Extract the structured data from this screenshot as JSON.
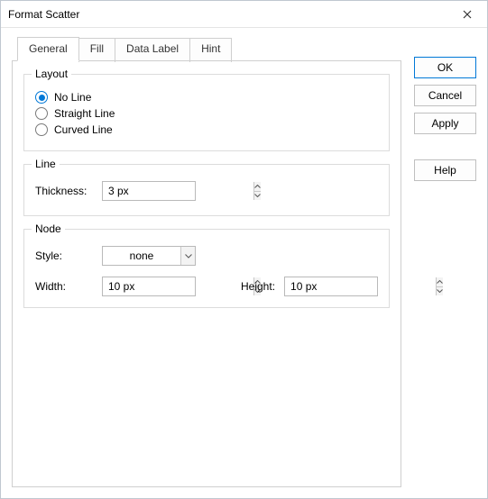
{
  "window": {
    "title": "Format Scatter"
  },
  "tabs": {
    "general": "General",
    "fill": "Fill",
    "data_label": "Data Label",
    "hint": "Hint"
  },
  "layout": {
    "title": "Layout",
    "no_line": "No Line",
    "straight_line": "Straight Line",
    "curved_line": "Curved Line",
    "selected": "no_line"
  },
  "line": {
    "title": "Line",
    "thickness_label": "Thickness:",
    "thickness_value": "3 px"
  },
  "node": {
    "title": "Node",
    "style_label": "Style:",
    "style_value": "none",
    "width_label": "Width:",
    "width_value": "10 px",
    "height_label": "Height:",
    "height_value": "10 px"
  },
  "buttons": {
    "ok": "OK",
    "cancel": "Cancel",
    "apply": "Apply",
    "help": "Help"
  }
}
